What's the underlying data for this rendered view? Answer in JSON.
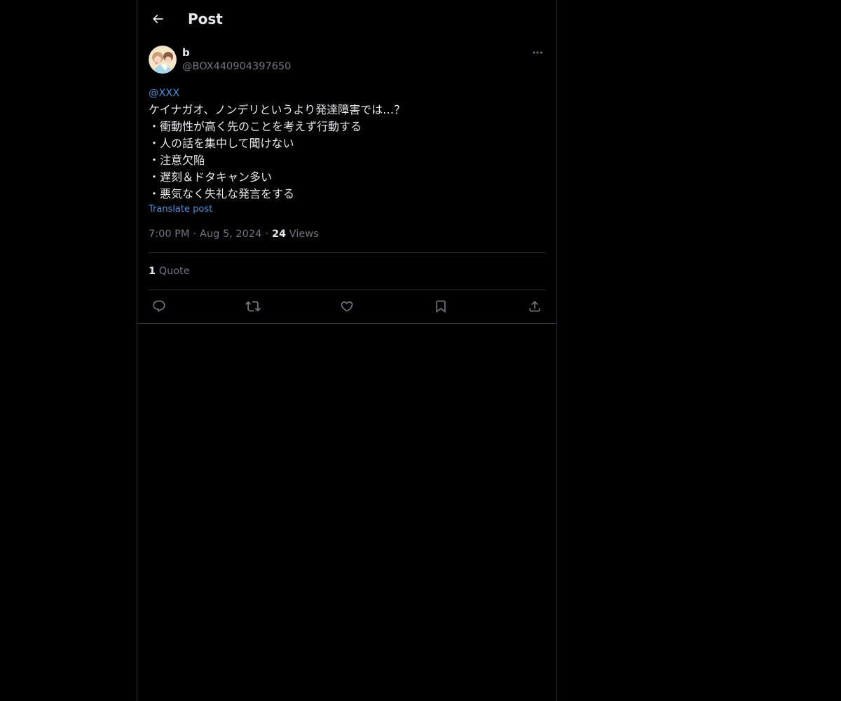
{
  "header": {
    "title": "Post",
    "back_icon": "arrow-left-icon"
  },
  "post": {
    "author": {
      "display_name": "b",
      "handle": "@BOX440904397650"
    },
    "mention": "@XXX",
    "lines": [
      "ケイナガオ、ノンデリというより発達障害では…？",
      "・衝動性が高く先のことを考えず行動する",
      "・人の話を集中して聞けない",
      "・注意欠陥",
      "・遅刻＆ドタキャン多い",
      "・悪気なく失礼な発言をする"
    ],
    "translate_label": "Translate post",
    "time": "7:00 PM",
    "date": "Aug 5, 2024",
    "views_count": "24",
    "views_label": "Views",
    "quote_count": "1",
    "quote_label": "Quote",
    "actions": [
      "reply-icon",
      "repost-icon",
      "like-icon",
      "bookmark-icon",
      "share-icon"
    ]
  },
  "colors": {
    "background": "#000000",
    "text": "#e7e9ea",
    "muted": "#71767b",
    "link": "#4a8fd8",
    "border": "#2f3336"
  }
}
